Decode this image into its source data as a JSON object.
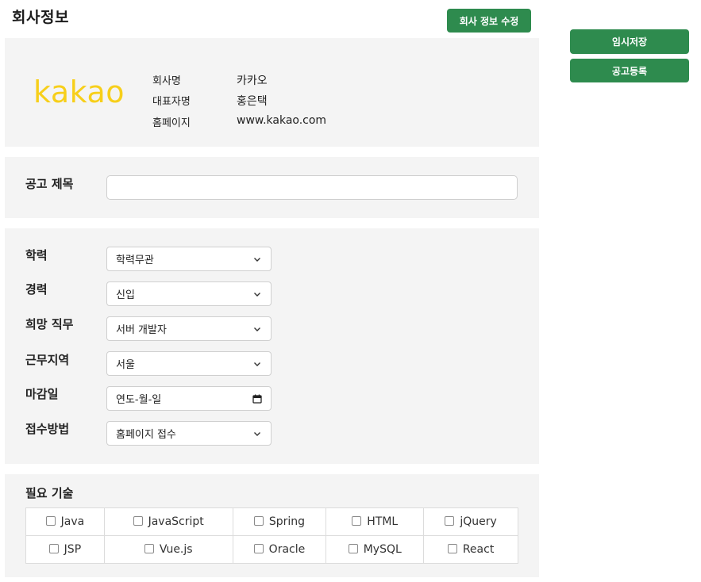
{
  "header": {
    "title": "회사정보",
    "edit_button": "회사 정보 수정"
  },
  "side_actions": {
    "temp_save": "임시저장",
    "post": "공고등록"
  },
  "company": {
    "logo_text": "kakao",
    "logo_color": "#f7cf1a",
    "name_label": "회사명",
    "name_value": "카카오",
    "ceo_label": "대표자명",
    "ceo_value": "홍은택",
    "homepage_label": "홈페이지",
    "homepage_value": "www.kakao.com"
  },
  "posting_title": {
    "label": "공고 제목",
    "value": ""
  },
  "conditions": [
    {
      "label": "학력",
      "value": "학력무관",
      "control": "select",
      "icon": "chevron-down-icon"
    },
    {
      "label": "경력",
      "value": "신입",
      "control": "select",
      "icon": "chevron-down-icon"
    },
    {
      "label": "희망 직무",
      "value": "서버 개발자",
      "control": "select",
      "icon": "chevron-down-icon"
    },
    {
      "label": "근무지역",
      "value": "서울",
      "control": "select",
      "icon": "chevron-down-icon"
    },
    {
      "label": "마감일",
      "value": "연도-월-일",
      "control": "date",
      "icon": "calendar-icon"
    },
    {
      "label": "접수방법",
      "value": "홈페이지 접수",
      "control": "select",
      "icon": "chevron-down-icon"
    }
  ],
  "skills": {
    "title": "필요 기술",
    "rows": [
      [
        "Java",
        "JavaScript",
        "Spring",
        "HTML",
        "jQuery"
      ],
      [
        "JSP",
        "Vue.js",
        "Oracle",
        "MySQL",
        "React"
      ]
    ]
  },
  "colors": {
    "accent": "#2e8b4e",
    "panel_bg": "#f4f4f4"
  }
}
